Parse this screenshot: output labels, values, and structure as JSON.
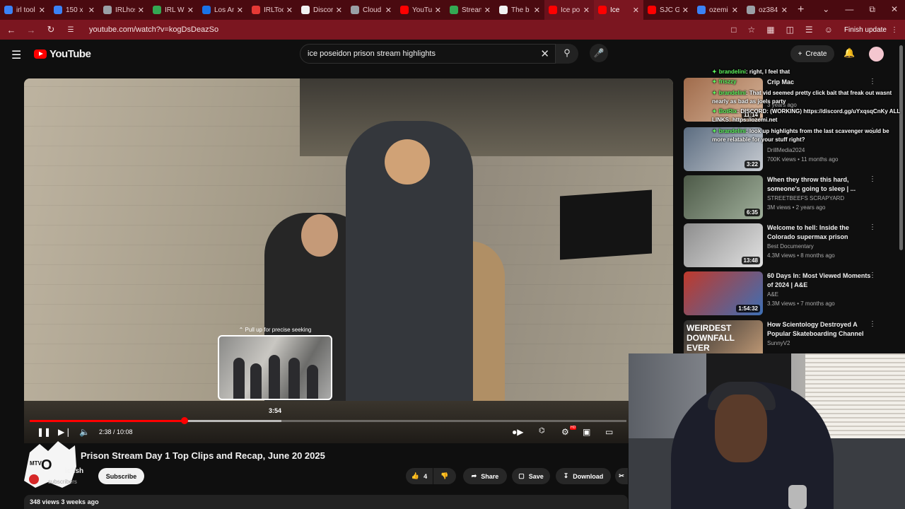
{
  "browser": {
    "tabs": [
      {
        "label": "irl tool",
        "color": "#3b82f6"
      },
      {
        "label": "150 x",
        "color": "#3b82f6"
      },
      {
        "label": "IRLhos",
        "color": "#9aa0a6"
      },
      {
        "label": "IRL W",
        "color": "#34a853"
      },
      {
        "label": "Los An",
        "color": "#1a73e8"
      },
      {
        "label": "IRLToo",
        "color": "#e53935"
      },
      {
        "label": "Discor",
        "color": "#f1f1f1"
      },
      {
        "label": "Cloud",
        "color": "#9aa0a6"
      },
      {
        "label": "YouTu",
        "color": "#ff0000"
      },
      {
        "label": "Strean",
        "color": "#34a853"
      },
      {
        "label": "The b",
        "color": "#f1f1f1"
      },
      {
        "label": "Ice po",
        "color": "#ff0000"
      },
      {
        "label": "Ice",
        "color": "#ff0000"
      },
      {
        "label": "SJC Gi",
        "color": "#ff0000"
      },
      {
        "label": "ozemi",
        "color": "#3b82f6"
      },
      {
        "label": "oz384",
        "color": "#9aa0a6"
      }
    ],
    "url": "youtube.com/watch?v=kogDsDeazSo",
    "finish_update": "Finish update"
  },
  "youtube": {
    "logo_text": "YouTube",
    "search_query": "ice poseidon prison stream highlights",
    "create_label": "Create"
  },
  "player": {
    "seek_hint": "Pull up for precise seeking",
    "seek_time": "3:54",
    "time_display": "2:38 / 10:08",
    "progress_fraction": 0.26,
    "hd_badge": "HD"
  },
  "video": {
    "title": "Prison Stream Day 1 Top Clips and Recap, June 20 2025",
    "channel": "icfish",
    "subscribers": "subscribers",
    "subscribe_label": "Subscribe",
    "likes": "4",
    "share_label": "Share",
    "save_label": "Save",
    "download_label": "Download",
    "meta": "348 views  3 weeks ago"
  },
  "overlay_chat": [
    {
      "user": "brandelini",
      "text": ": right, I feel that"
    },
    {
      "user": "friszzy",
      "text": ""
    },
    {
      "user": "brandelini",
      "text": ": That vid seemed pretty click bait that freak out wasnt nearly as bad as joels party"
    },
    {
      "user": "BotRix",
      "text": ": DISCORD: (WORKING) https://discord.gg/uYxqsqCnKy ALL LINKS: https://ozemi.net"
    },
    {
      "user": "brandelini",
      "text": ": look up highlights from the last scavenger would be more relatable for your stuff right?"
    }
  ],
  "recommendations": [
    {
      "title": "Crip Mac",
      "channel": "",
      "meta": "3 years ago",
      "duration": "11:14",
      "colors": [
        "#a06b4b",
        "#d7b59a"
      ]
    },
    {
      "title": "",
      "channel": "DrillMedia2024",
      "meta": "700K views • 11 months ago",
      "duration": "3:22",
      "colors": [
        "#5b6c80",
        "#c8ccd2"
      ]
    },
    {
      "title": "When they throw this hard, someone's going to sleep | ...",
      "channel": "STREETBEEFS SCRAPYARD",
      "meta": "3M views • 2 years ago",
      "duration": "6:35",
      "colors": [
        "#4d5a48",
        "#9fae9a"
      ]
    },
    {
      "title": "Welcome to hell: Inside the Colorado supermax prison",
      "channel": "Best Documentary",
      "meta": "4.3M views • 8 months ago",
      "duration": "13:48",
      "colors": [
        "#8d8d8d",
        "#e2e2e2"
      ]
    },
    {
      "title": "60 Days In: Most Viewed Moments of 2024 | A&E",
      "channel": "A&E",
      "meta": "3.3M views • 7 months ago",
      "duration": "1:54:32",
      "colors": [
        "#c0392b",
        "#3d6fb5"
      ]
    },
    {
      "title": "How Scientology Destroyed A Popular Skateboarding Channel",
      "channel": "SunnyV2",
      "meta": "",
      "duration": "",
      "thumb_text": "WEIRDEST DOWNFALL EVER",
      "colors": [
        "#2b2b2b",
        "#c9a07a"
      ]
    }
  ]
}
